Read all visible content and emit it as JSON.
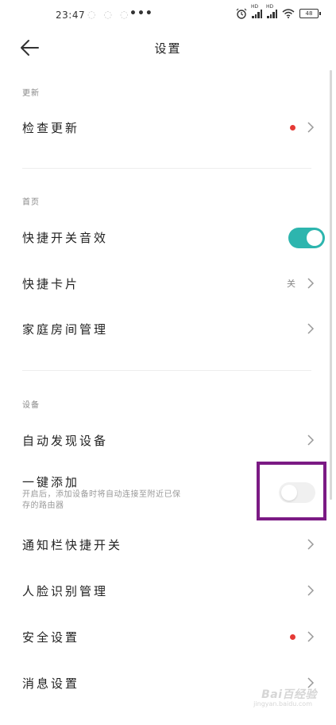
{
  "status_bar": {
    "time": "23:47",
    "more_dots": "•••",
    "battery_level": "48",
    "signal_badge": "HD"
  },
  "header": {
    "title": "设置"
  },
  "sections": {
    "update": {
      "label": "更新",
      "check_update": {
        "label": "检查更新",
        "has_red_dot": true
      }
    },
    "homepage": {
      "label": "首页",
      "quick_switch_sound": {
        "label": "快捷开关音效",
        "toggle_on": true
      },
      "quick_card": {
        "label": "快捷卡片",
        "value": "关"
      },
      "room_management": {
        "label": "家庭房间管理"
      }
    },
    "device": {
      "label": "设备",
      "auto_discover": {
        "label": "自动发现设备"
      },
      "one_click_add": {
        "label": "一键添加",
        "description_line1": "开启后，添加设备时将自动连接至附近已保",
        "description_line2": "存的路由器",
        "toggle_on": false
      },
      "notification_shortcut": {
        "label": "通知栏快捷开关"
      },
      "face_recognition": {
        "label": "人脸识别管理"
      },
      "security": {
        "label": "安全设置",
        "has_red_dot": true
      },
      "message": {
        "label": "消息设置"
      }
    }
  },
  "colors": {
    "toggle_on": "#2db5ae",
    "red_dot": "#e53935",
    "highlight": "#7b1a84"
  },
  "watermark": {
    "text": "Bai百经验",
    "sub": "jingyan.baidu.com"
  }
}
